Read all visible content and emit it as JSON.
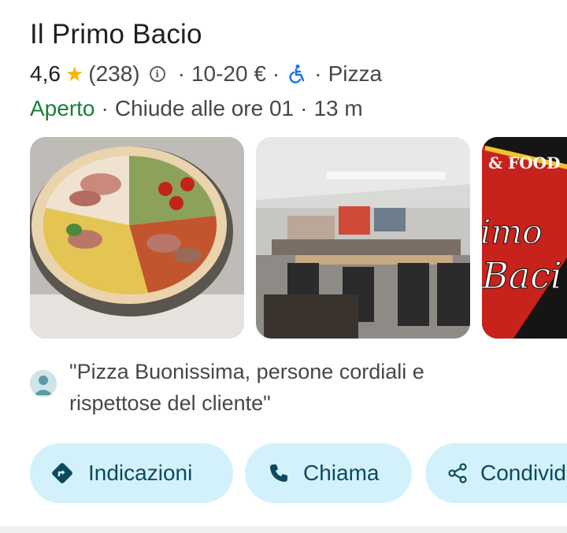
{
  "place": {
    "name": "Il Primo Bacio",
    "rating": "4,6",
    "review_count": "(238)",
    "price_range": "10-20 €",
    "category": "Pizza",
    "status": "Aperto",
    "hours": "Chiude alle ore 01",
    "distance": "13 m",
    "separator": "·"
  },
  "photos": [
    {
      "icon": "pizza-photo"
    },
    {
      "icon": "restaurant-interior-photo"
    },
    {
      "icon": "logo-photo",
      "text_top": "& FOOD",
      "text_mid": "imo",
      "text_bot": "Baci"
    }
  ],
  "review": {
    "text": "\"Pizza Buonissima, persone cordiali e rispettose del cliente\""
  },
  "actions": {
    "directions": "Indicazioni",
    "call": "Chiama",
    "share": "Condividi"
  },
  "colors": {
    "open": "#188038",
    "star": "#f5b400",
    "chip_bg": "#d3f1fb",
    "chip_text": "#0b4a5e",
    "accessibility": "#1a73e8"
  }
}
